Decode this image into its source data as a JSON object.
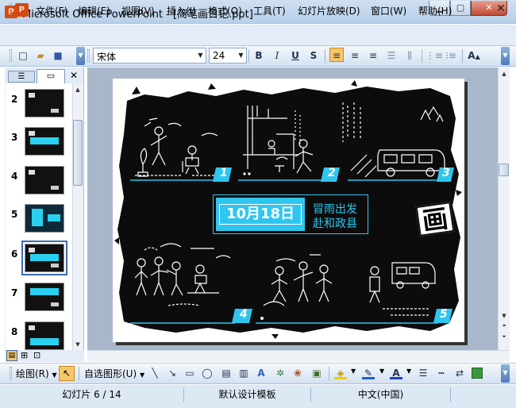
{
  "window": {
    "title": "Microsoft Office PowerPoint - [简笔画日记.ppt]",
    "app_letter": "P"
  },
  "menu": {
    "items": [
      "文件(F)",
      "编辑(E)",
      "视图(V)",
      "插入(I)",
      "格式(O)",
      "工具(T)",
      "幻灯片放映(D)",
      "窗口(W)",
      "帮助(H)"
    ]
  },
  "toolbar": {
    "font_name": "宋体",
    "font_size": "24",
    "bold": "B",
    "italic": "I",
    "underline": "U",
    "shadow": "S",
    "font_color_label": "A"
  },
  "slides_panel": {
    "numbers": [
      "2",
      "3",
      "4",
      "5",
      "6",
      "7",
      "8"
    ],
    "selected": "6"
  },
  "slide": {
    "date": "10月18日",
    "caption_line1": "冒雨出发",
    "caption_line2": "赴和政县",
    "markers": [
      "1",
      "2",
      "3",
      "4",
      "5"
    ],
    "stamp": "画"
  },
  "drawbar": {
    "draw_label": "绘图(R)",
    "autoshape_label": "自选图形(U)"
  },
  "status": {
    "slide_pos": "幻灯片 6 / 14",
    "template": "默认设计模板",
    "language": "中文(中国)"
  },
  "colors": {
    "accent": "#2fc6ee",
    "selection": "#3c6bb0"
  }
}
